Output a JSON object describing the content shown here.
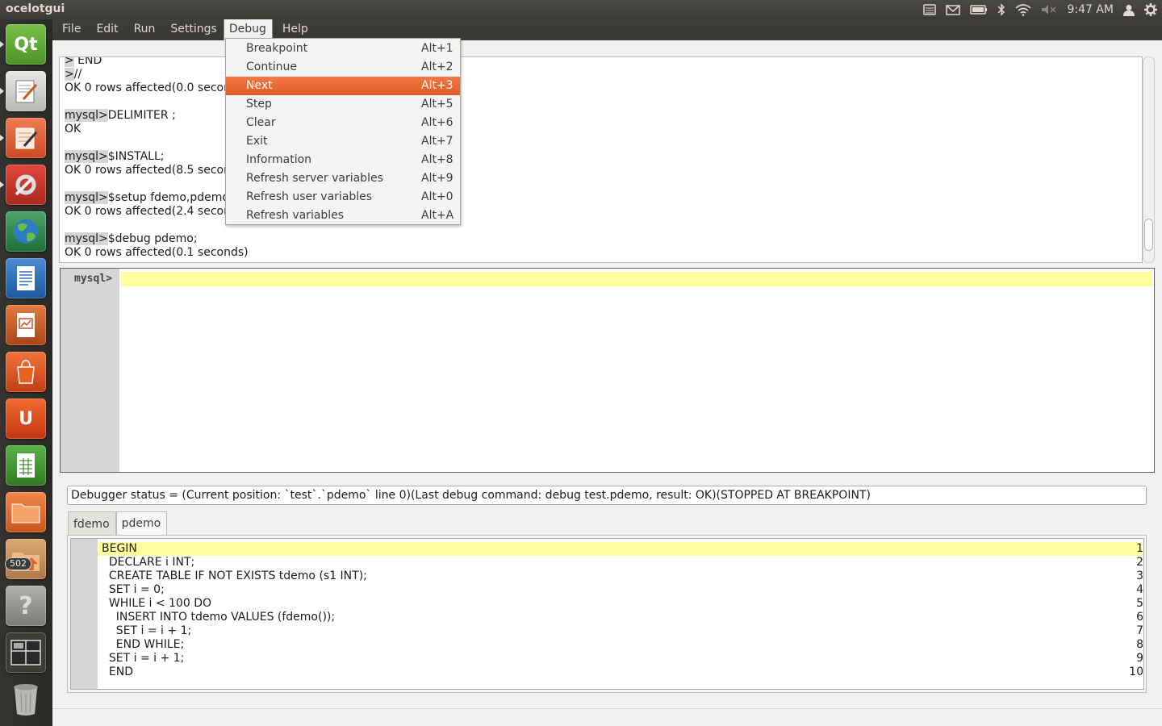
{
  "topbar": {
    "app_title": "ocelotgui",
    "clock": "9:47 AM",
    "indicator_icons": [
      "keyboard-icon",
      "mail-icon",
      "battery-icon",
      "bluetooth-icon",
      "wifi-icon",
      "volume-muted-icon",
      "user-icon",
      "settings-gear-icon"
    ]
  },
  "launcher": {
    "badge": "502",
    "items": [
      {
        "name": "qt-creator",
        "label": "Qt",
        "color": "#5aa632"
      },
      {
        "name": "text-editor",
        "label": "",
        "color": "#d7d7d4"
      },
      {
        "name": "notepad",
        "label": "",
        "color": "#e25c3a"
      },
      {
        "name": "system-settings",
        "label": "",
        "color": "#c43a2b"
      },
      {
        "name": "web-browser",
        "label": "",
        "color": "#2f8a4d"
      },
      {
        "name": "writer",
        "label": "",
        "color": "#2f6fb4"
      },
      {
        "name": "impress",
        "label": "",
        "color": "#c35421"
      },
      {
        "name": "software-center",
        "label": "",
        "color": "#d54f24"
      },
      {
        "name": "ubuntu-one",
        "label": "U",
        "color": "#dd4814"
      },
      {
        "name": "calc",
        "label": "",
        "color": "#3c8e2e"
      },
      {
        "name": "files",
        "label": "",
        "color": "#e06c2a"
      },
      {
        "name": "downloads",
        "label": "",
        "color": "#c9864a"
      },
      {
        "name": "help",
        "label": "?",
        "color": "#8a8a86"
      },
      {
        "name": "workspaces",
        "label": "",
        "color": "#4a4a47"
      },
      {
        "name": "trash",
        "label": "",
        "color": "#5c5c59"
      }
    ]
  },
  "menubar": {
    "items": [
      "File",
      "Edit",
      "Run",
      "Settings",
      "Debug",
      "Help"
    ],
    "active": "Debug"
  },
  "debug_menu": {
    "items": [
      {
        "label": "Breakpoint",
        "shortcut": "Alt+1"
      },
      {
        "label": "Continue",
        "shortcut": "Alt+2"
      },
      {
        "label": "Next",
        "shortcut": "Alt+3",
        "highlighted": true
      },
      {
        "label": "Step",
        "shortcut": "Alt+5"
      },
      {
        "label": "Clear",
        "shortcut": "Alt+6"
      },
      {
        "label": "Exit",
        "shortcut": "Alt+7"
      },
      {
        "label": "Information",
        "shortcut": "Alt+8"
      },
      {
        "label": "Refresh server variables",
        "shortcut": "Alt+9"
      },
      {
        "label": "Refresh user variables",
        "shortcut": "Alt+0"
      },
      {
        "label": "Refresh variables",
        "shortcut": "Alt+A"
      }
    ]
  },
  "history": {
    "lines": [
      {
        "prompt": ">",
        "text": " END"
      },
      {
        "prompt": ">",
        "text": "//"
      },
      {
        "prompt": "",
        "text": "OK 0 rows affected(0.0 seconds)"
      },
      {
        "prompt": "",
        "text": ""
      },
      {
        "prompt": "mysql>",
        "text": "DELIMITER ;"
      },
      {
        "prompt": "",
        "text": "OK"
      },
      {
        "prompt": "",
        "text": ""
      },
      {
        "prompt": "mysql>",
        "text": "$INSTALL;"
      },
      {
        "prompt": "",
        "text": "OK 0 rows affected(8.5 seconds)"
      },
      {
        "prompt": "",
        "text": ""
      },
      {
        "prompt": "mysql>",
        "text": "$setup fdemo,pdemo;"
      },
      {
        "prompt": "",
        "text": "OK 0 rows affected(2.4 seconds)"
      },
      {
        "prompt": "",
        "text": ""
      },
      {
        "prompt": "mysql>",
        "text": "$debug pdemo;"
      },
      {
        "prompt": "",
        "text": "OK 0 rows affected(0.1 seconds)"
      }
    ]
  },
  "editor": {
    "prompt": "mysql>",
    "value": ""
  },
  "debugger": {
    "status": "Debugger status = (Current position: `test`.`pdemo` line 0)(Last debug command: debug test.pdemo, result: OK)(STOPPED AT BREAKPOINT)",
    "tabs": [
      "fdemo",
      "pdemo"
    ],
    "selected_tab": "pdemo",
    "code": [
      {
        "n": "1",
        "text": "BEGIN"
      },
      {
        "n": "2",
        "text": "  DECLARE i INT;"
      },
      {
        "n": "3",
        "text": "  CREATE TABLE IF NOT EXISTS tdemo (s1 INT);"
      },
      {
        "n": "4",
        "text": "  SET i = 0;"
      },
      {
        "n": "5",
        "text": "  WHILE i < 100 DO"
      },
      {
        "n": "6",
        "text": "    INSERT INTO tdemo VALUES (fdemo());"
      },
      {
        "n": "7",
        "text": "    SET i = i + 1;"
      },
      {
        "n": "8",
        "text": "    END WHILE;"
      },
      {
        "n": "9",
        "text": "  SET i = i + 1;"
      },
      {
        "n": "10",
        "text": "  END"
      }
    ]
  },
  "colors": {
    "menu_highlight": "#e9632c",
    "current_line": "#fefe9e",
    "panel": "#3c3b37"
  }
}
